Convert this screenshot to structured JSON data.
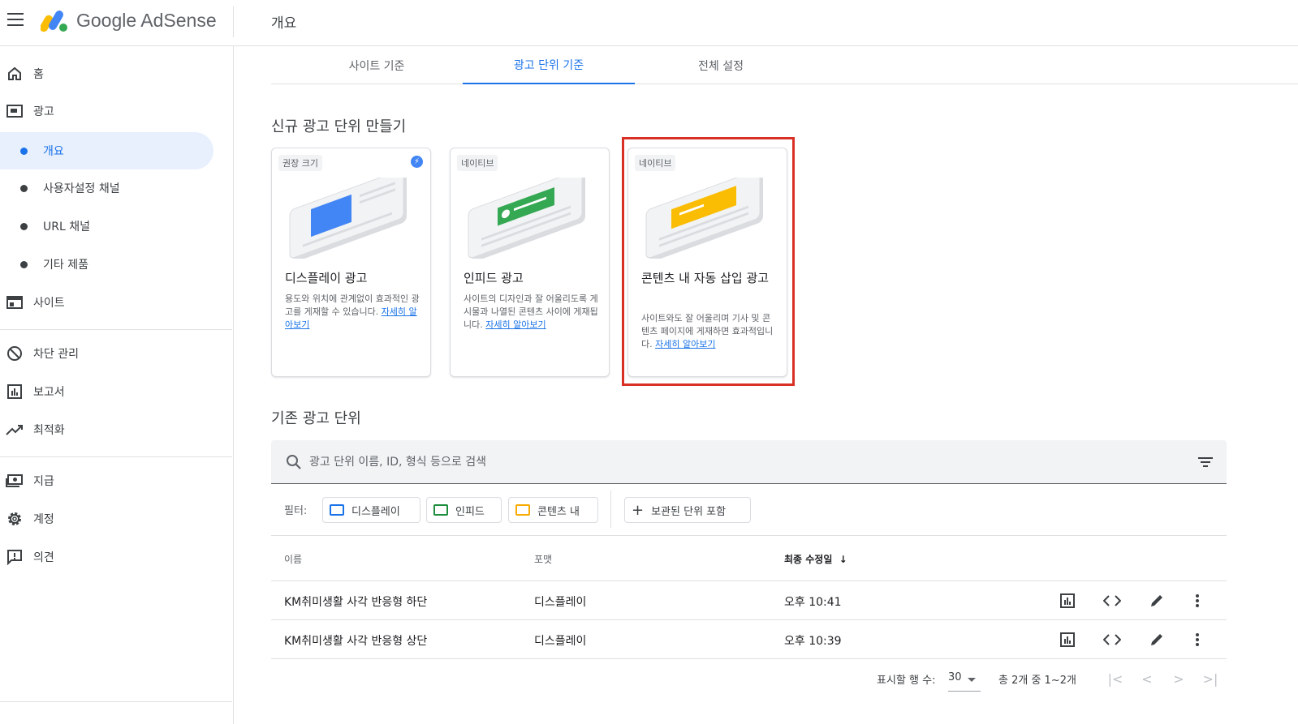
{
  "app": {
    "brand": "Google AdSense",
    "page_title": "개요"
  },
  "sidebar": {
    "items": [
      {
        "label": "홈",
        "icon": "home-icon"
      },
      {
        "label": "광고",
        "icon": "ads-icon"
      },
      {
        "label": "사이트",
        "icon": "sites-icon"
      },
      {
        "label": "차단 관리",
        "icon": "block-icon"
      },
      {
        "label": "보고서",
        "icon": "reports-icon"
      },
      {
        "label": "최적화",
        "icon": "optimize-icon"
      },
      {
        "label": "지급",
        "icon": "payments-icon"
      },
      {
        "label": "계정",
        "icon": "gear-icon"
      },
      {
        "label": "의견",
        "icon": "feedback-icon"
      }
    ],
    "sub_items": [
      {
        "label": "개요",
        "active": true
      },
      {
        "label": "사용자설정 채널",
        "active": false
      },
      {
        "label": "URL 채널",
        "active": false
      },
      {
        "label": "기타 제품",
        "active": false
      }
    ]
  },
  "tabs": [
    {
      "label": "사이트 기준",
      "active": false
    },
    {
      "label": "광고 단위 기준",
      "active": true
    },
    {
      "label": "전체 설정",
      "active": false
    }
  ],
  "new_units": {
    "title": "신규 광고 단위 만들기",
    "cards": [
      {
        "tag": "권장 크기",
        "title": "디스플레이 광고",
        "desc": "용도와 위치에 관계없이 효과적인 광고를 게재할 수 있습니다.",
        "link": "자세히 알아보기",
        "accent": "#4285f4"
      },
      {
        "tag": "네이티브",
        "title": "인피드 광고",
        "desc": "사이트의 디자인과 잘 어울리도록 게시물과 나열된 콘텐츠 사이에 게재됩니다.",
        "link": "자세히 알아보기",
        "accent": "#34a853"
      },
      {
        "tag": "네이티브",
        "title": "콘텐츠 내 자동 삽입 광고",
        "desc": "사이트와도 잘 어울리며 기사 및 콘텐츠 페이지에 게재하면 효과적입니다.",
        "link": "자세히 알아보기",
        "accent": "#fbbc04"
      }
    ]
  },
  "existing_units": {
    "title": "기존 광고 단위",
    "search_placeholder": "광고 단위 이름, ID, 형식 등으로 검색",
    "filter_label": "필터:",
    "chips": [
      {
        "label": "디스플레이",
        "color": "#1a73e8"
      },
      {
        "label": "인피드",
        "color": "#1e8e3e"
      },
      {
        "label": "콘텐츠 내",
        "color": "#f9ab00"
      }
    ],
    "archived_chip": "보관된 단위 포함",
    "columns": {
      "name": "이름",
      "format": "포맷",
      "modified": "최종 수정일"
    },
    "rows": [
      {
        "name": "KM취미생활 사각 반응형 하단",
        "format": "디스플레이",
        "modified": "오후 10:41"
      },
      {
        "name": "KM취미생활 사각 반응형 상단",
        "format": "디스플레이",
        "modified": "오후 10:39"
      }
    ],
    "pagination": {
      "rows_label": "표시할 행 수:",
      "rows_value": "30",
      "range": "총 2개 중 1~2개"
    }
  }
}
